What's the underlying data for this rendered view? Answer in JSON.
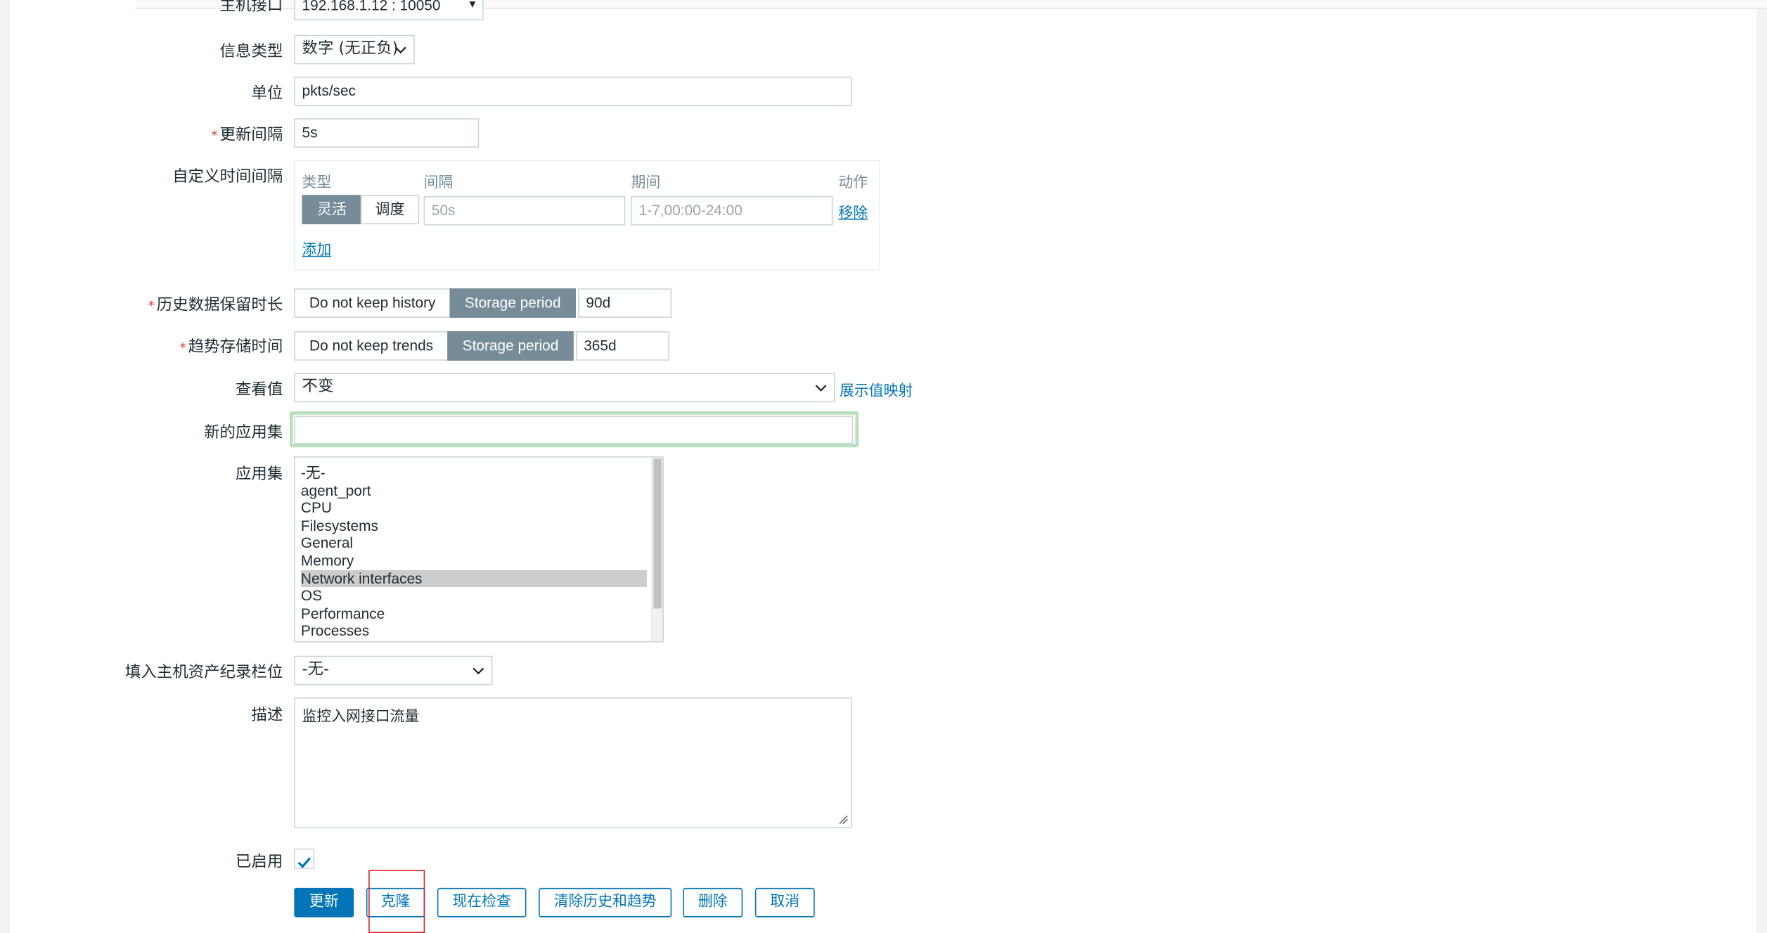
{
  "form": {
    "host_interface": {
      "label": "主机接口",
      "value": "192.168.1.12 : 10050"
    },
    "info_type": {
      "label": "信息类型",
      "value": "数字 (无正负)"
    },
    "units": {
      "label": "单位",
      "value": "pkts/sec"
    },
    "update_interval": {
      "label": "更新间隔",
      "value": "5s",
      "required_mark": "*"
    },
    "custom_intervals": {
      "label": "自定义时间间隔",
      "headers": [
        "类型",
        "间隔",
        "期间",
        "动作"
      ],
      "row": {
        "type_options": [
          "灵活",
          "调度"
        ],
        "active_type": "灵活",
        "interval_placeholder": "50s",
        "period_placeholder": "1-7,00:00-24:00",
        "remove_label": "移除"
      },
      "add_label": "添加"
    },
    "history": {
      "label": "历史数据保留时长",
      "required_mark": "*",
      "options": [
        "Do not keep history",
        "Storage period"
      ],
      "active": "Storage period",
      "value": "90d"
    },
    "trends": {
      "label": "趋势存储时间",
      "required_mark": "*",
      "options": [
        "Do not keep trends",
        "Storage period"
      ],
      "active": "Storage period",
      "value": "365d"
    },
    "show_value": {
      "label": "查看值",
      "value": "不变",
      "link": "展示值映射"
    },
    "new_application": {
      "label": "新的应用集",
      "value": ""
    },
    "applications": {
      "label": "应用集",
      "items": [
        "-无-",
        "agent_port",
        "CPU",
        "Filesystems",
        "General",
        "Memory",
        "Network interfaces",
        "OS",
        "Performance",
        "Processes"
      ],
      "selected": "Network interfaces"
    },
    "inventory_field": {
      "label": "填入主机资产纪录栏位",
      "value": "-无-"
    },
    "description": {
      "label": "描述",
      "value": "监控入网接口流量"
    },
    "enabled": {
      "label": "已启用",
      "checked": true
    }
  },
  "buttons": {
    "update": "更新",
    "clone": "克隆",
    "check_now": "现在检查",
    "clear_history": "清除历史和趋势",
    "delete": "删除",
    "cancel": "取消"
  },
  "colors": {
    "primary": "#0275b8",
    "segment_active": "#768d99",
    "highlight_frame": "#e0202a",
    "focus_ring": "#b9e0bd",
    "required": "#e33734"
  }
}
